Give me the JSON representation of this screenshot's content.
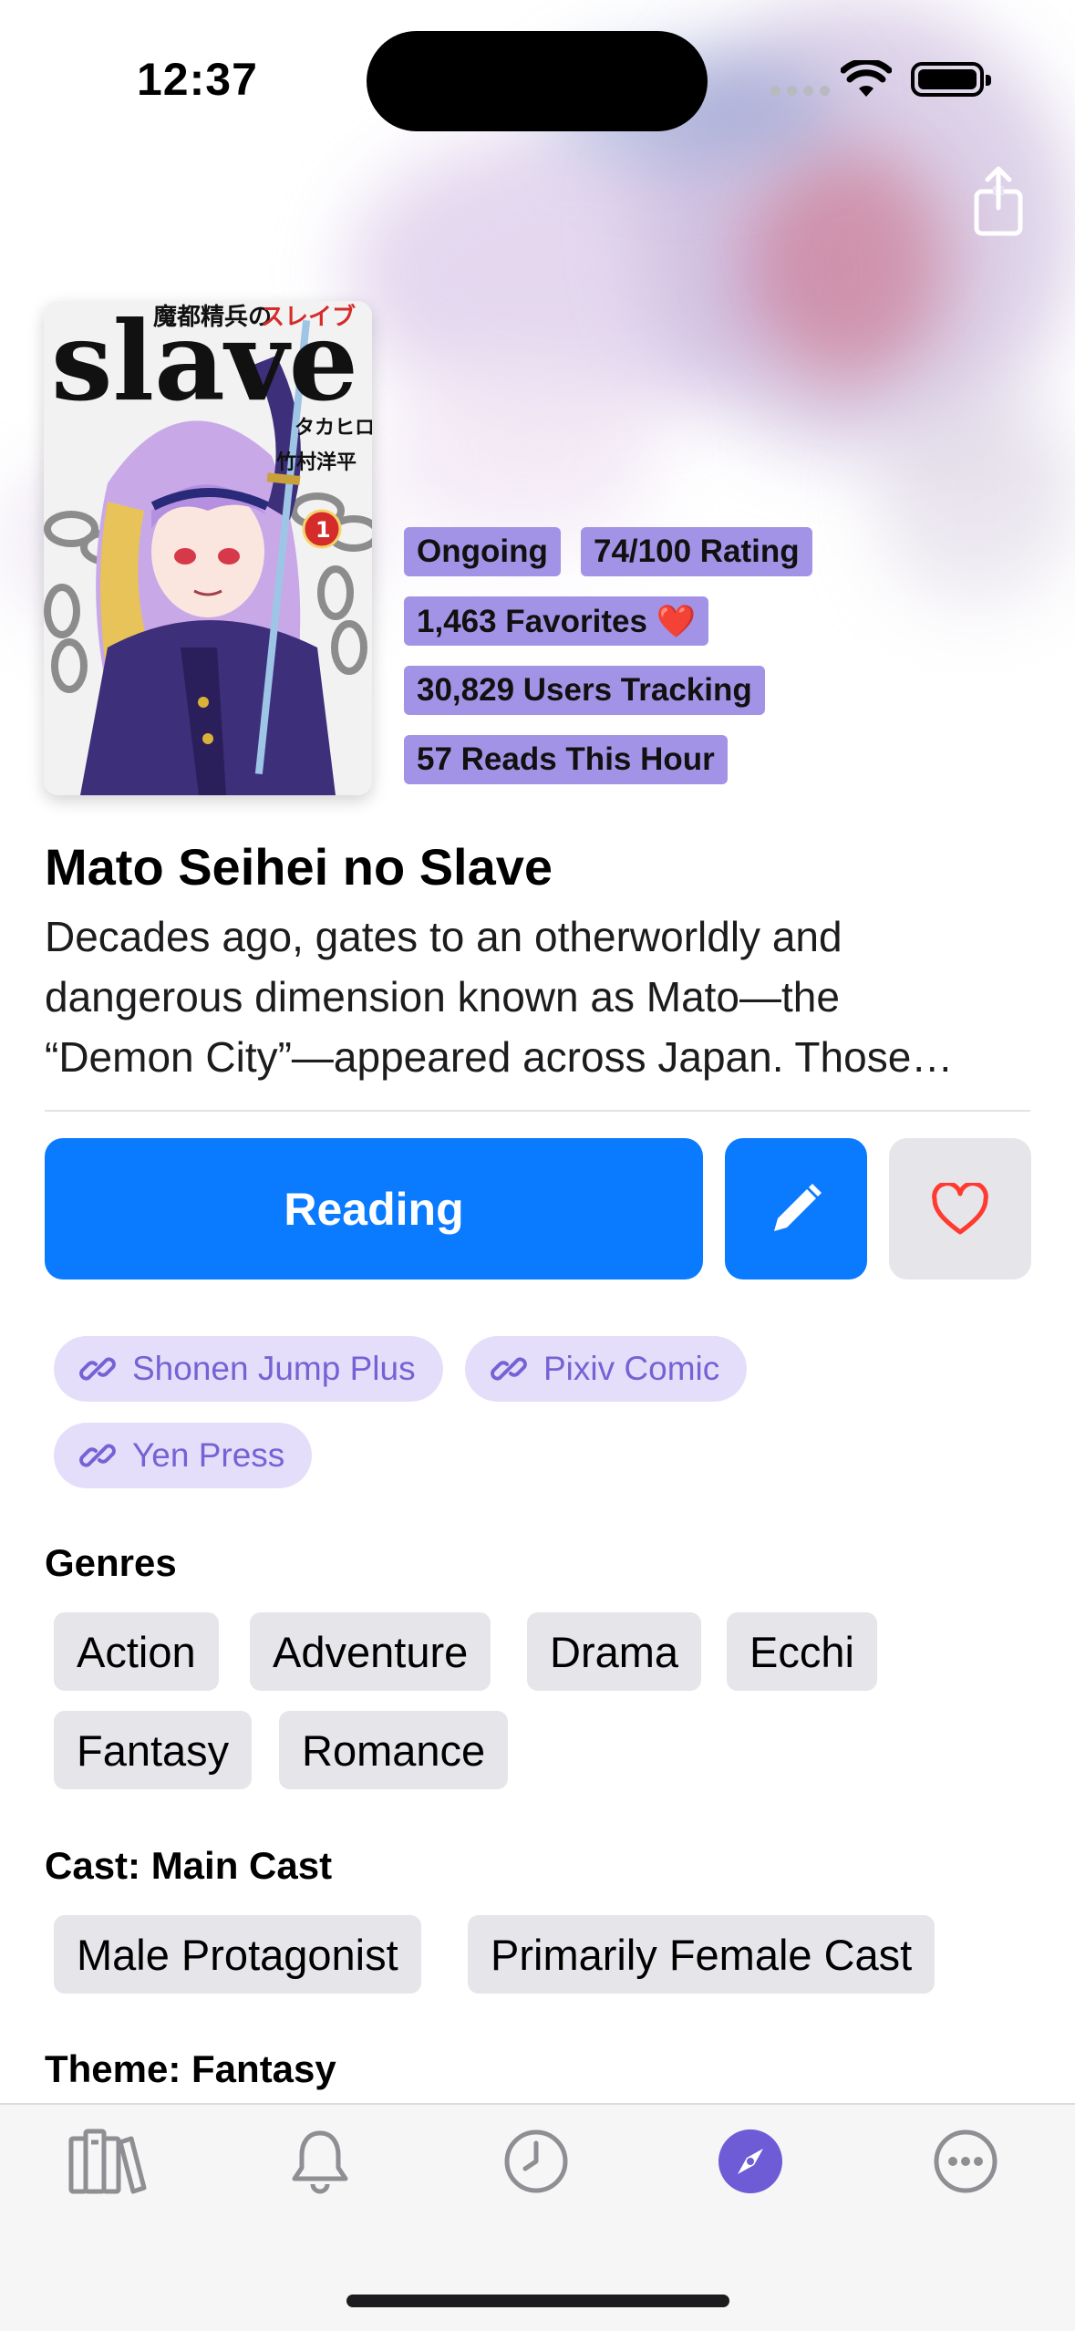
{
  "status_bar": {
    "time": "12:37"
  },
  "cover": {
    "title_jp": "魔都精兵の",
    "title_kana": "スレイブ",
    "title_latin": "slave",
    "author_credit": "タカヒロ",
    "artist_credit": "竹村洋平",
    "volume": "1"
  },
  "stats": {
    "status": "Ongoing",
    "rating": "74/100 Rating",
    "favorites": "1,463 Favorites ❤️",
    "tracking": "30,829 Users Tracking",
    "reads": "57 Reads This Hour"
  },
  "manga": {
    "title": "Mato Seihei no Slave",
    "description_lines": [
      "Decades ago, gates to an otherworldly and",
      "dangerous dimension known as Mato—the",
      "“Demon City”—appeared across Japan. Those…"
    ]
  },
  "actions": {
    "reading_label": "Reading",
    "edit_icon": "pencil-icon",
    "favorite_icon": "heart-outline-icon"
  },
  "links": [
    "Shonen Jump Plus",
    "Pixiv Comic",
    "Yen Press"
  ],
  "sections": {
    "genres_label": "Genres",
    "cast_label": "Cast: Main Cast",
    "theme_label": "Theme: Fantasy"
  },
  "genres": [
    "Action",
    "Adventure",
    "Drama",
    "Ecchi",
    "Fantasy",
    "Romance"
  ],
  "cast": [
    "Male Protagonist",
    "Primarily Female Cast"
  ],
  "tab_bar": {
    "items": [
      "library-icon",
      "bell-icon",
      "clock-icon",
      "compass-icon",
      "more-icon"
    ],
    "active_index": 3
  },
  "colors": {
    "accent_blue": "#0a7aff",
    "badge_purple": "#a393e6",
    "link_chip_bg": "#e5defa",
    "link_chip_text": "#7563d5",
    "tab_active": "#6e5bd6",
    "heart_red": "#ff3b30"
  }
}
